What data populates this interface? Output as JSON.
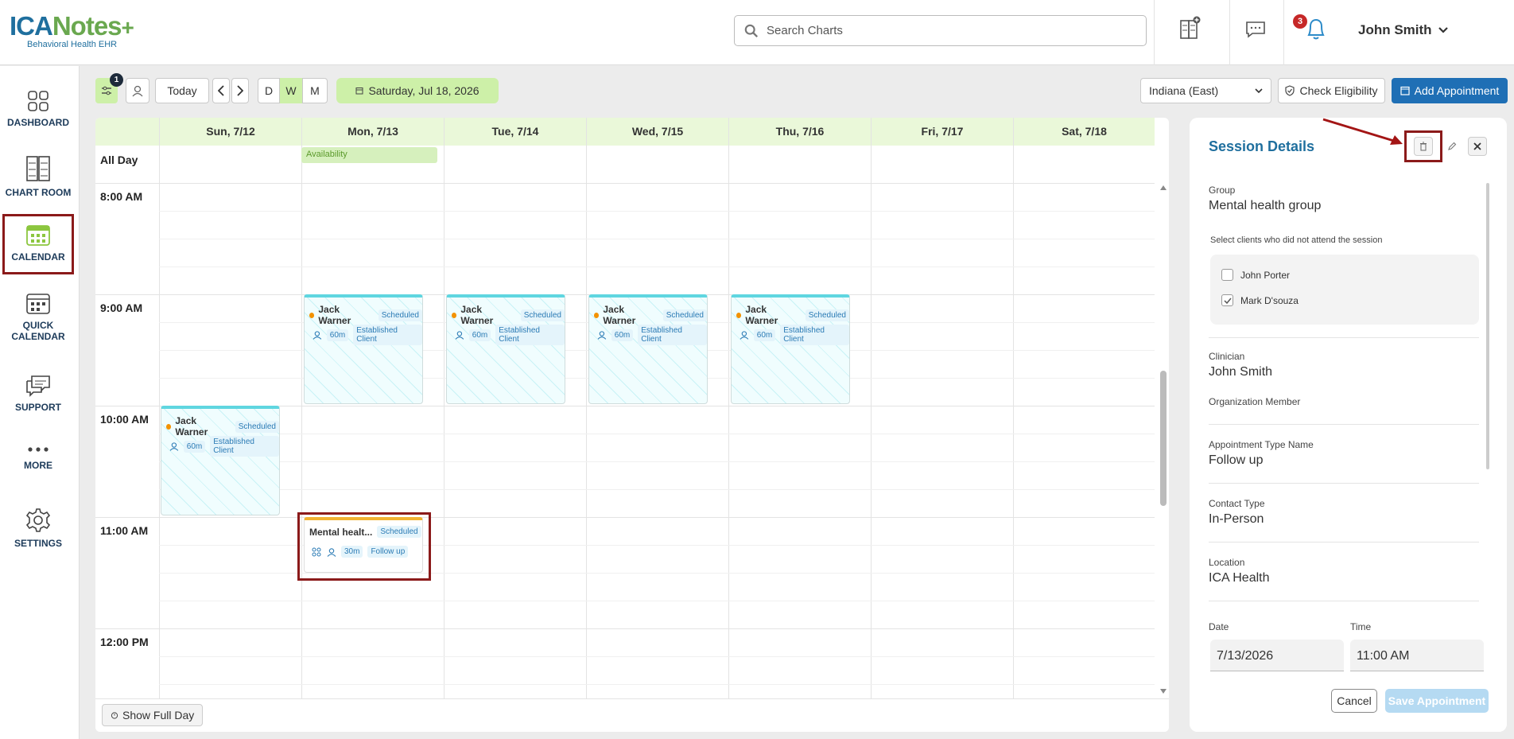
{
  "header": {
    "logo_main_1": "ICA",
    "logo_main_2": "Notes",
    "logo_sub": "Behavioral Health EHR",
    "search_placeholder": "Search Charts",
    "notification_count": "3",
    "user_name": "John Smith"
  },
  "nav": {
    "dashboard": "DASHBOARD",
    "chart_room": "CHART ROOM",
    "calendar": "CALENDAR",
    "quick_1": "QUICK",
    "quick_2": "CALENDAR",
    "support": "SUPPORT",
    "more": "MORE",
    "settings": "SETTINGS"
  },
  "toolbar": {
    "filter_count": "1",
    "today": "Today",
    "view_d": "D",
    "view_w": "W",
    "view_m": "M",
    "date": "Saturday, Jul 18, 2026",
    "timezone": "Indiana (East)",
    "check_eligibility": "Check Eligibility",
    "add_appointment": "Add Appointment"
  },
  "calendar": {
    "days": [
      "Sun, 7/12",
      "Mon, 7/13",
      "Tue, 7/14",
      "Wed, 7/15",
      "Thu, 7/16",
      "Fri, 7/17",
      "Sat, 7/18"
    ],
    "all_day": "All Day",
    "availability": "Availability",
    "times": [
      "8:00 AM",
      "9:00 AM",
      "10:00 AM",
      "11:00 AM",
      "12:00 PM"
    ],
    "appointment": {
      "client": "Jack Warner",
      "status": "Scheduled",
      "duration": "60m",
      "type": "Established Client"
    },
    "group_appointment": {
      "title": "Mental healt...",
      "status": "Scheduled",
      "duration": "30m",
      "type": "Follow up"
    },
    "show_full_day": "Show Full Day"
  },
  "panel": {
    "title": "Session Details",
    "group_label": "Group",
    "group_value": "Mental health group",
    "attend_label": "Select clients who did not attend the session",
    "clients": [
      {
        "name": "John Porter",
        "checked": false
      },
      {
        "name": "Mark D'souza",
        "checked": true
      }
    ],
    "clinician_label": "Clinician",
    "clinician_value": "John Smith",
    "org_member_label": "Organization Member",
    "appt_type_label": "Appointment Type Name",
    "appt_type_value": "Follow up",
    "contact_type_label": "Contact Type",
    "contact_type_value": "In-Person",
    "location_label": "Location",
    "location_value": "ICA Health",
    "date_label": "Date",
    "date_value": "7/13/2026",
    "time_label": "Time",
    "time_value": "11:00 AM",
    "cancel": "Cancel",
    "save": "Save Appointment"
  }
}
